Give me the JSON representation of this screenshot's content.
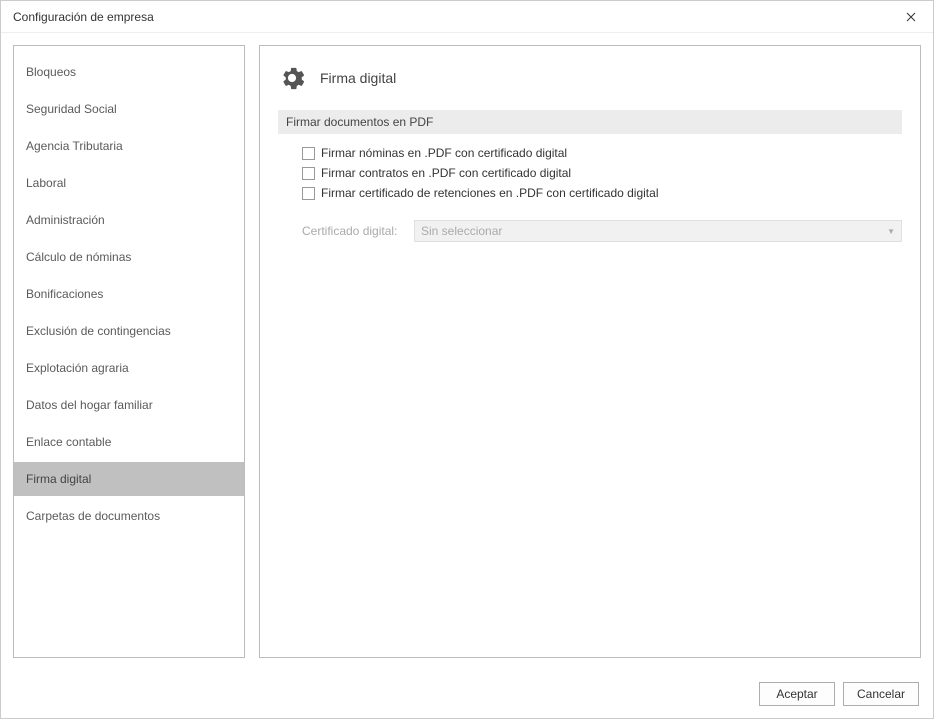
{
  "window": {
    "title": "Configuración de empresa"
  },
  "sidebar": {
    "items": [
      {
        "label": "Bloqueos"
      },
      {
        "label": "Seguridad Social"
      },
      {
        "label": "Agencia Tributaria"
      },
      {
        "label": "Laboral"
      },
      {
        "label": "Administración"
      },
      {
        "label": "Cálculo de nóminas"
      },
      {
        "label": "Bonificaciones"
      },
      {
        "label": "Exclusión de contingencias"
      },
      {
        "label": "Explotación agraria"
      },
      {
        "label": "Datos del hogar familiar"
      },
      {
        "label": "Enlace contable"
      },
      {
        "label": "Firma digital"
      },
      {
        "label": "Carpetas de documentos"
      }
    ],
    "active_index": 11
  },
  "main": {
    "page_title": "Firma digital",
    "section_title": "Firmar documentos en PDF",
    "checkboxes": [
      {
        "label": "Firmar nóminas en .PDF con certificado digital",
        "checked": false
      },
      {
        "label": "Firmar contratos en .PDF con certificado digital",
        "checked": false
      },
      {
        "label": "Firmar certificado de retenciones en .PDF con certificado digital",
        "checked": false
      }
    ],
    "cert_label": "Certificado digital:",
    "cert_value": "Sin seleccionar"
  },
  "footer": {
    "accept": "Aceptar",
    "cancel": "Cancelar"
  }
}
